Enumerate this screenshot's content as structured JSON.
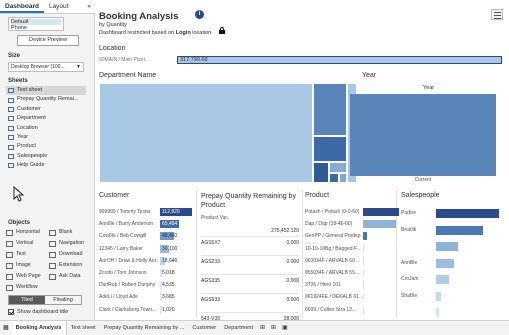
{
  "left_panel": {
    "tabs": [
      "Dashboard",
      "Layout"
    ],
    "collapse": "«",
    "device_list": [
      "Default",
      "Phone"
    ],
    "device_preview_label": "Device Preview",
    "size_label": "Size",
    "size_value": "Desktop Browser (100...",
    "sheets_label": "Sheets",
    "sheets": [
      "Text sheet",
      "Prepay Quantity Remai...",
      "Customer",
      "Department",
      "Location",
      "Year",
      "Product",
      "Salespeople",
      "Help Guide"
    ],
    "objects_label": "Objects",
    "objects": [
      "Horizontal",
      "Blank",
      "Vertical",
      "Navigation",
      "Text",
      "Download",
      "Image",
      "Extension",
      "Web Page",
      "Ask Data",
      "Workflow"
    ],
    "tiled_label": "Tiled",
    "floating_label": "Floating",
    "show_title_label": "Show dashboard title"
  },
  "bottom_tabs": [
    "Booking Analysis",
    "Text sheet",
    "Prepay Quantity Remaining by ...",
    "Customer",
    "Department"
  ],
  "header": {
    "title": "Booking Analysis",
    "info": "i",
    "subtitle": "by Quantity",
    "restrict_pre": "Dashboard restricted based on ",
    "restrict_bold": "Login",
    "restrict_post": " location."
  },
  "location": {
    "header": "Location",
    "label": "00MA/N / Main Plant",
    "bar_text": "317,799.68"
  },
  "department": {
    "header": "Department Name"
  },
  "year": {
    "header": "Year",
    "label": "Year",
    "axis": "Current"
  },
  "customer": {
    "header": "Customer",
    "rows": [
      {
        "name": "999999 / Tommy Tester",
        "value": "112,820",
        "frac": 1.0,
        "color": "#2b4a8b",
        "light": true
      },
      {
        "name": "Ann8le / Barry Anderson",
        "value": "65,454",
        "frac": 0.58,
        "color": "#3f6aa5",
        "light": true
      },
      {
        "name": "Cow8le / Bob Cowgill",
        "value": "48,460",
        "frac": 0.43,
        "color": "#6f97c9",
        "light": false
      },
      {
        "name": "12345 / Larry Baker",
        "value": "30,100",
        "frac": 0.27,
        "color": "#9dbde0",
        "light": false
      },
      {
        "name": "AorOH / Drew & Holly Aor...",
        "value": "18,646",
        "frac": 0.17,
        "color": "#bcd2ea",
        "light": false
      },
      {
        "name": "Zcotto / Tom Johnson",
        "value": "5,018",
        "frac": 0.0,
        "color": "#dbe7f4",
        "light": false
      },
      {
        "name": "DunRup / Robert Dunphy",
        "value": "4,535",
        "frac": 0.0,
        "color": "#dbe7f4",
        "light": false
      },
      {
        "name": "AdeLl / Lloyd Ade",
        "value": "3,685",
        "frac": 0.0,
        "color": "#dbe7f4",
        "light": false
      },
      {
        "name": "Clark / Clarksburg Town...",
        "value": "1,020",
        "frac": 0.0,
        "color": "#dbe7f4",
        "light": false
      }
    ]
  },
  "prepay": {
    "header": "Prepay Quantity Remaining by Product",
    "col_header": "Product Var..",
    "total": "275,452.120",
    "rows": [
      {
        "name": "AGS5X7",
        "value": "0.000"
      },
      {
        "name": "AGS233",
        "value": "0.000"
      },
      {
        "name": "AGS335",
        "value": "0.000"
      },
      {
        "name": "AGS533",
        "value": "0.000"
      },
      {
        "name": "543-V33",
        "value": "28.000"
      }
    ]
  },
  "product": {
    "header": "Product",
    "rows": [
      {
        "name": "Potash / Potash (0-0-60)",
        "frac": 1.0,
        "color": "#2b4a8b"
      },
      {
        "name": "Dap / Dap (18-46-00)",
        "frac": 0.92,
        "color": "#8fb2d9"
      },
      {
        "name": "GenPP / General Predep",
        "frac": 0.12,
        "color": "#4a78b5"
      },
      {
        "name": "10-10-10Bg / Bagged F...",
        "frac": 0.0,
        "color": "#dbe7f4"
      },
      {
        "name": "063034F / ARVALB 60...",
        "frac": 0.0,
        "color": "#dbe7f4"
      },
      {
        "name": "055034F / ARVALB 55...",
        "frac": 0.0,
        "color": "#dbe7f4"
      },
      {
        "name": "3736 / Hero 101",
        "frac": 0.0,
        "color": "#dbe7f4"
      },
      {
        "name": "061924FE / DEKALB 61...",
        "frac": 0.0,
        "color": "#dbe7f4"
      },
      {
        "name": "6699 / Caltex Stra 12...",
        "frac": 0.0,
        "color": "#dbe7f4"
      }
    ]
  },
  "salespeople": {
    "header": "Salespeople",
    "rows": [
      {
        "name": "Parbre",
        "frac": 1.0,
        "color": "#2b4a8b"
      },
      {
        "name": "Bearlik",
        "frac": 0.75,
        "color": "#4a78b5"
      },
      {
        "name": "",
        "frac": 0.35,
        "color": "#8fb2d9"
      },
      {
        "name": "AnnBle",
        "frac": 0.28,
        "color": "#9dbde0"
      },
      {
        "name": "CroJam",
        "frac": 0.2,
        "color": "#b3cce6"
      },
      {
        "name": "ShaBle",
        "frac": 0.08,
        "color": "#c9daed"
      },
      {
        "name": "",
        "frac": 0.05,
        "color": "#d8e5f2"
      }
    ]
  },
  "treemap_colors": [
    "#a9c8e6",
    "#7ea7d3",
    "#5a85b8",
    "#3c6aa6",
    "#2f5a94",
    "#3f6aa5",
    "#86acd6"
  ]
}
